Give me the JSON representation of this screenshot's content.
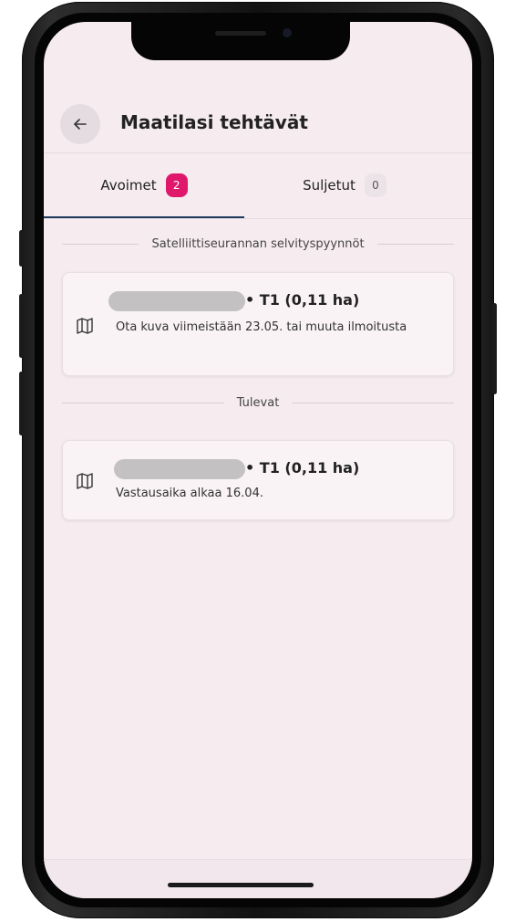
{
  "header": {
    "title": "Maatilasi tehtävät",
    "back_icon": "arrow-left-icon"
  },
  "tabs": [
    {
      "label": "Avoimet",
      "count": "2",
      "active": true
    },
    {
      "label": "Suljetut",
      "count": "0",
      "active": false
    }
  ],
  "sections": [
    {
      "heading": "Satelliittiseurannan selvityspyynnöt",
      "items": [
        {
          "plot": "• T1 (0,11 ha)",
          "description": "Ota kuva viimeistään 23.05. tai muuta ilmoitusta",
          "icon": "map-icon"
        }
      ]
    },
    {
      "heading": "Tulevat",
      "items": [
        {
          "plot": "• T1 (0,11 ha)",
          "description": "Vastausaika alkaa 16.04.",
          "icon": "map-icon"
        }
      ]
    }
  ],
  "colors": {
    "accent": "#e0186c",
    "tab_indicator": "#1f3a5a",
    "background": "#f6ecf0"
  }
}
